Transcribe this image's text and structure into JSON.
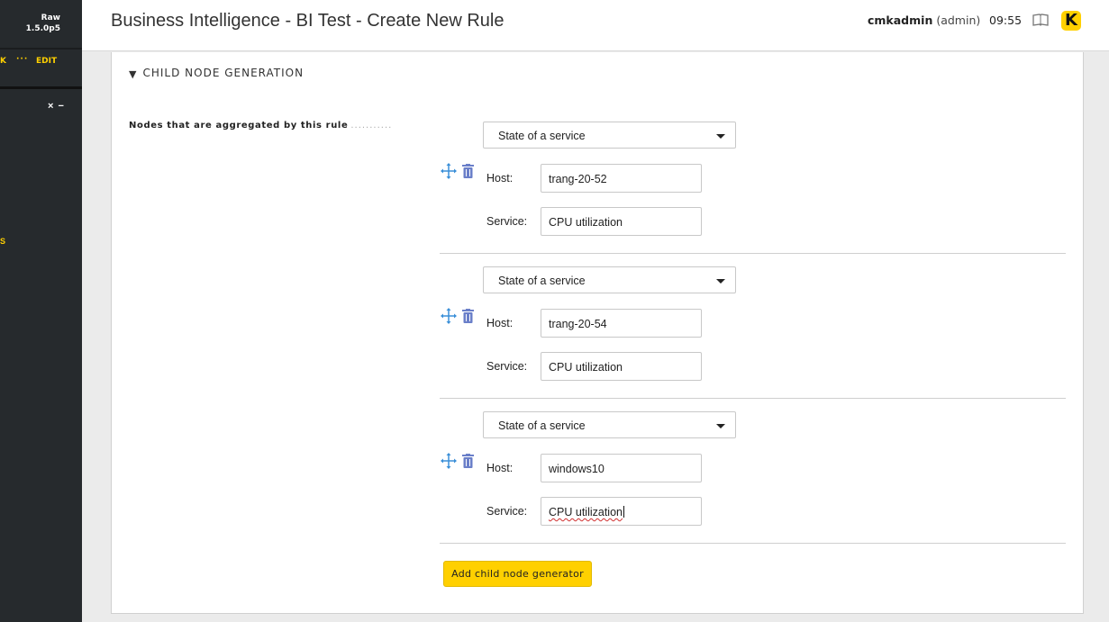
{
  "sidebar": {
    "edition": "Raw",
    "version": "1.5.0p5",
    "edit_bar_left_fragment": "K",
    "edit_bar_dots": "···",
    "edit_label": "EDIT",
    "close_glyph": "×",
    "minimize_glyph": "−",
    "mid_fragment": "S"
  },
  "header": {
    "title": "Business Intelligence - BI Test - Create New Rule",
    "username": "cmkadmin",
    "role": "(admin)",
    "time": "09:55",
    "logo_letter": "K"
  },
  "section": {
    "heading": "CHILD NODE GENERATION",
    "field_label": "Nodes that are aggregated by this rule",
    "field_label_dots": "...........",
    "host_label": "Host:",
    "service_label": "Service:",
    "nodes": [
      {
        "type": "State of a service",
        "host": "trang-20-52",
        "service": "CPU utilization"
      },
      {
        "type": "State of a service",
        "host": "trang-20-54",
        "service": "CPU utilization"
      },
      {
        "type": "State of a service",
        "host": "windows10",
        "service": "CPU utilization"
      }
    ],
    "add_button_label": "Add child node generator"
  },
  "colors": {
    "accent": "#ffd000",
    "sidebar_bg": "#262a2d",
    "icon_blue": "#3a8fd8",
    "trash_blue": "#6a7fc9"
  }
}
